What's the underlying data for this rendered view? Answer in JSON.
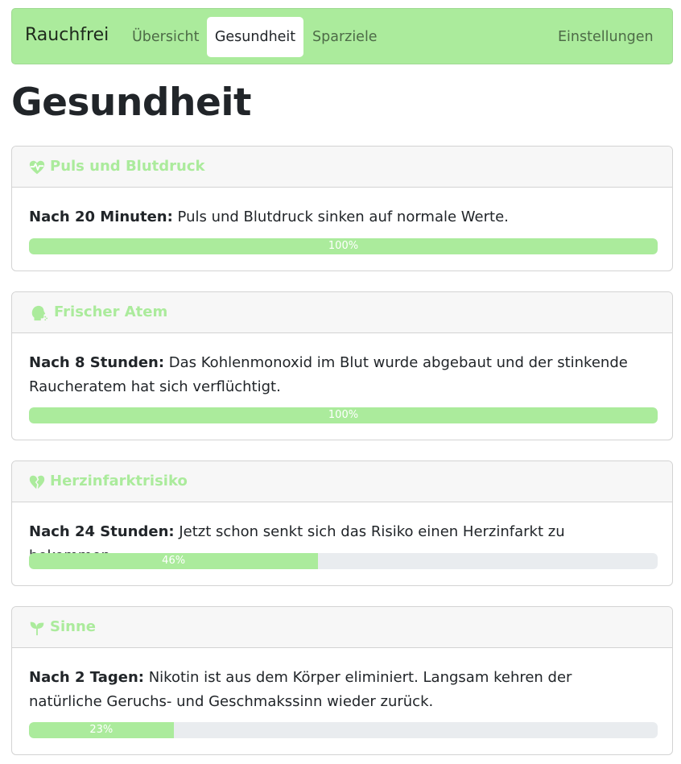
{
  "nav": {
    "brand": "Rauchfrei",
    "items": [
      {
        "label": "Übersicht",
        "active": false
      },
      {
        "label": "Gesundheit",
        "active": true
      },
      {
        "label": "Sparziele",
        "active": false
      }
    ],
    "settings": "Einstellungen"
  },
  "page_title": "Gesundheit",
  "colors": {
    "accent": "#abeb9c",
    "track": "#e9ecef"
  },
  "cards": [
    {
      "icon": "heartbeat-icon",
      "title": "Puls und Blutdruck",
      "time": "Nach 20 Minuten:",
      "text": " Puls und Blutdruck sinken auf normale Werte.",
      "progress": 100,
      "progress_label": "100%"
    },
    {
      "icon": "head-breath-icon",
      "title": "Frischer Atem",
      "time": "Nach 8 Stunden:",
      "text": " Das Kohlenmonoxid im Blut wurde abgebaut und der stinkende Raucheratem hat sich verflüchtigt.",
      "progress": 100,
      "progress_label": "100%"
    },
    {
      "icon": "heart-broken-icon",
      "title": "Herzinfarktrisiko",
      "time": "Nach 24 Stunden:",
      "text": " Jetzt schon senkt sich das Risiko einen Herzinfarkt zu bekommen.",
      "progress": 46,
      "progress_label": "46%"
    },
    {
      "icon": "seedling-icon",
      "title": "Sinne",
      "time": "Nach 2 Tagen:",
      "text": " Nikotin ist aus dem Körper eliminiert. Langsam kehren der natürliche Geruchs- und Geschmakssinn wieder zurück.",
      "progress": 23,
      "progress_label": "23%"
    }
  ]
}
